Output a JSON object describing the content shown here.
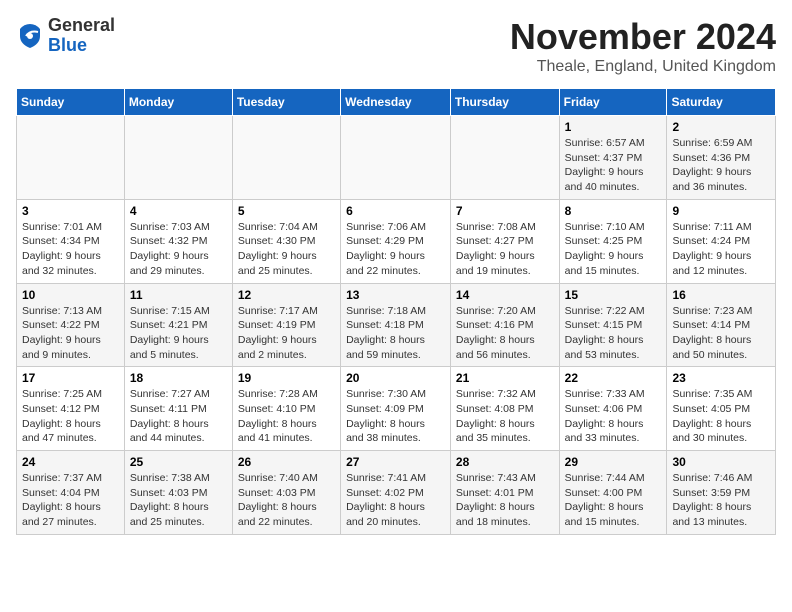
{
  "header": {
    "logo_general": "General",
    "logo_blue": "Blue",
    "month_title": "November 2024",
    "location": "Theale, England, United Kingdom"
  },
  "weekdays": [
    "Sunday",
    "Monday",
    "Tuesday",
    "Wednesday",
    "Thursday",
    "Friday",
    "Saturday"
  ],
  "weeks": [
    [
      {
        "day": "",
        "info": ""
      },
      {
        "day": "",
        "info": ""
      },
      {
        "day": "",
        "info": ""
      },
      {
        "day": "",
        "info": ""
      },
      {
        "day": "",
        "info": ""
      },
      {
        "day": "1",
        "info": "Sunrise: 6:57 AM\nSunset: 4:37 PM\nDaylight: 9 hours\nand 40 minutes."
      },
      {
        "day": "2",
        "info": "Sunrise: 6:59 AM\nSunset: 4:36 PM\nDaylight: 9 hours\nand 36 minutes."
      }
    ],
    [
      {
        "day": "3",
        "info": "Sunrise: 7:01 AM\nSunset: 4:34 PM\nDaylight: 9 hours\nand 32 minutes."
      },
      {
        "day": "4",
        "info": "Sunrise: 7:03 AM\nSunset: 4:32 PM\nDaylight: 9 hours\nand 29 minutes."
      },
      {
        "day": "5",
        "info": "Sunrise: 7:04 AM\nSunset: 4:30 PM\nDaylight: 9 hours\nand 25 minutes."
      },
      {
        "day": "6",
        "info": "Sunrise: 7:06 AM\nSunset: 4:29 PM\nDaylight: 9 hours\nand 22 minutes."
      },
      {
        "day": "7",
        "info": "Sunrise: 7:08 AM\nSunset: 4:27 PM\nDaylight: 9 hours\nand 19 minutes."
      },
      {
        "day": "8",
        "info": "Sunrise: 7:10 AM\nSunset: 4:25 PM\nDaylight: 9 hours\nand 15 minutes."
      },
      {
        "day": "9",
        "info": "Sunrise: 7:11 AM\nSunset: 4:24 PM\nDaylight: 9 hours\nand 12 minutes."
      }
    ],
    [
      {
        "day": "10",
        "info": "Sunrise: 7:13 AM\nSunset: 4:22 PM\nDaylight: 9 hours\nand 9 minutes."
      },
      {
        "day": "11",
        "info": "Sunrise: 7:15 AM\nSunset: 4:21 PM\nDaylight: 9 hours\nand 5 minutes."
      },
      {
        "day": "12",
        "info": "Sunrise: 7:17 AM\nSunset: 4:19 PM\nDaylight: 9 hours\nand 2 minutes."
      },
      {
        "day": "13",
        "info": "Sunrise: 7:18 AM\nSunset: 4:18 PM\nDaylight: 8 hours\nand 59 minutes."
      },
      {
        "day": "14",
        "info": "Sunrise: 7:20 AM\nSunset: 4:16 PM\nDaylight: 8 hours\nand 56 minutes."
      },
      {
        "day": "15",
        "info": "Sunrise: 7:22 AM\nSunset: 4:15 PM\nDaylight: 8 hours\nand 53 minutes."
      },
      {
        "day": "16",
        "info": "Sunrise: 7:23 AM\nSunset: 4:14 PM\nDaylight: 8 hours\nand 50 minutes."
      }
    ],
    [
      {
        "day": "17",
        "info": "Sunrise: 7:25 AM\nSunset: 4:12 PM\nDaylight: 8 hours\nand 47 minutes."
      },
      {
        "day": "18",
        "info": "Sunrise: 7:27 AM\nSunset: 4:11 PM\nDaylight: 8 hours\nand 44 minutes."
      },
      {
        "day": "19",
        "info": "Sunrise: 7:28 AM\nSunset: 4:10 PM\nDaylight: 8 hours\nand 41 minutes."
      },
      {
        "day": "20",
        "info": "Sunrise: 7:30 AM\nSunset: 4:09 PM\nDaylight: 8 hours\nand 38 minutes."
      },
      {
        "day": "21",
        "info": "Sunrise: 7:32 AM\nSunset: 4:08 PM\nDaylight: 8 hours\nand 35 minutes."
      },
      {
        "day": "22",
        "info": "Sunrise: 7:33 AM\nSunset: 4:06 PM\nDaylight: 8 hours\nand 33 minutes."
      },
      {
        "day": "23",
        "info": "Sunrise: 7:35 AM\nSunset: 4:05 PM\nDaylight: 8 hours\nand 30 minutes."
      }
    ],
    [
      {
        "day": "24",
        "info": "Sunrise: 7:37 AM\nSunset: 4:04 PM\nDaylight: 8 hours\nand 27 minutes."
      },
      {
        "day": "25",
        "info": "Sunrise: 7:38 AM\nSunset: 4:03 PM\nDaylight: 8 hours\nand 25 minutes."
      },
      {
        "day": "26",
        "info": "Sunrise: 7:40 AM\nSunset: 4:03 PM\nDaylight: 8 hours\nand 22 minutes."
      },
      {
        "day": "27",
        "info": "Sunrise: 7:41 AM\nSunset: 4:02 PM\nDaylight: 8 hours\nand 20 minutes."
      },
      {
        "day": "28",
        "info": "Sunrise: 7:43 AM\nSunset: 4:01 PM\nDaylight: 8 hours\nand 18 minutes."
      },
      {
        "day": "29",
        "info": "Sunrise: 7:44 AM\nSunset: 4:00 PM\nDaylight: 8 hours\nand 15 minutes."
      },
      {
        "day": "30",
        "info": "Sunrise: 7:46 AM\nSunset: 3:59 PM\nDaylight: 8 hours\nand 13 minutes."
      }
    ]
  ]
}
